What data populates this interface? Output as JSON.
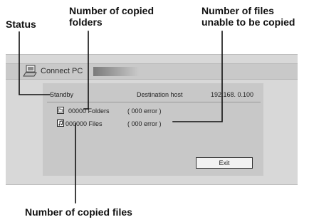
{
  "callouts": {
    "status": "Status",
    "copied_folders_1": "Number of copied",
    "copied_folders_2": "folders",
    "unable_1": "Number of files",
    "unable_2": "unable to be copied",
    "copied_files": "Number of copied files"
  },
  "window": {
    "title": "Connect PC",
    "title_icon": "pc-connect-icon"
  },
  "panel": {
    "status": "Standby",
    "host_label": "Destination host",
    "host_ip": "192.168.  0.100",
    "folders_value": "00000 Folders",
    "folders_error": "( 000  error )",
    "files_value": "000000 Files",
    "files_error": "( 000  error )",
    "folder_icon": "folder-icon",
    "file_icon": "music-file-icon"
  },
  "buttons": {
    "exit": "Exit"
  }
}
